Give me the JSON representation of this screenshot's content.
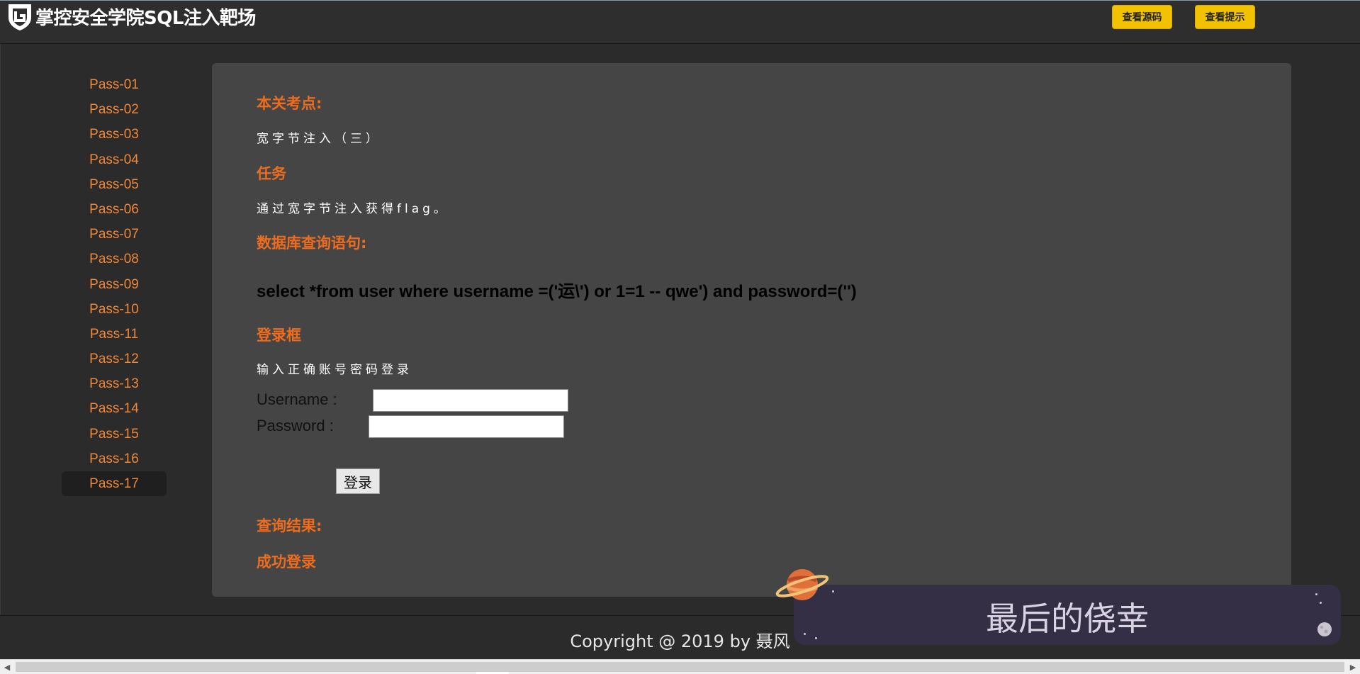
{
  "header": {
    "title": "掌控安全学院SQL注入靶场",
    "buttons": {
      "view_source": "查看源码",
      "view_hint": "查看提示"
    }
  },
  "sidebar": {
    "items": [
      {
        "label": "Pass-01"
      },
      {
        "label": "Pass-02"
      },
      {
        "label": "Pass-03"
      },
      {
        "label": "Pass-04"
      },
      {
        "label": "Pass-05"
      },
      {
        "label": "Pass-06"
      },
      {
        "label": "Pass-07"
      },
      {
        "label": "Pass-08"
      },
      {
        "label": "Pass-09"
      },
      {
        "label": "Pass-10"
      },
      {
        "label": "Pass-11"
      },
      {
        "label": "Pass-12"
      },
      {
        "label": "Pass-13"
      },
      {
        "label": "Pass-14"
      },
      {
        "label": "Pass-15"
      },
      {
        "label": "Pass-16"
      },
      {
        "label": "Pass-17"
      }
    ],
    "active": "Pass-17"
  },
  "main": {
    "checkpoint_title": "本关考点:",
    "checkpoint_text": "宽字节注入（三）",
    "task_title": "任务",
    "task_text": "通过宽字节注入获得flag。",
    "query_title": "数据库查询语句:",
    "query_sql": "select *from user where username =('运\\') or 1=1 -- qwe') and password=('')",
    "login_title": "登录框",
    "login_hint": "输入正确账号密码登录",
    "username_label": "Username :",
    "password_label": "Password :",
    "username_value": "",
    "password_value": "",
    "login_button": "登录",
    "result_title": "查询结果:",
    "result_text": "成功登录"
  },
  "footer": {
    "copyright": "Copyright @ 2019 by 聂风"
  },
  "music_widget": {
    "text": "最后的侥幸"
  },
  "colors": {
    "accent_orange": "#ee6c1e",
    "sidebar_orange": "#f0883a",
    "button_yellow": "#f2c200",
    "panel_bg": "#454545",
    "page_bg": "#2b2b2b"
  }
}
